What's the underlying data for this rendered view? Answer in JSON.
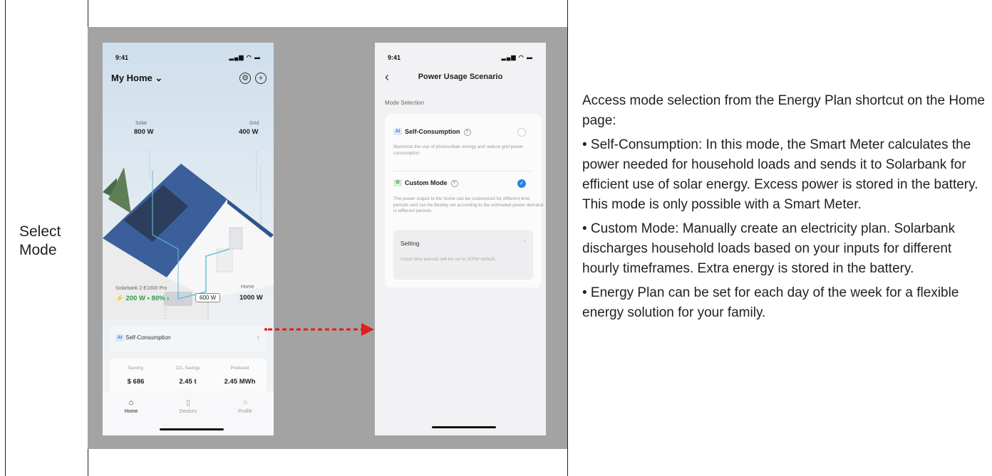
{
  "row_label": "Select\nMode",
  "phone1": {
    "time": "9:41",
    "status_icons": "▂▄▆ ◠ ▬",
    "title": "My Home ⌄",
    "solar_label": "Solar",
    "solar_value": "800 W",
    "grid_label": "Grid",
    "grid_value": "400 W",
    "device_label": "Solarbank 2 E1600 Pro",
    "device_value": "⚡ 200 W • 80% ›",
    "flow_value": "600 W",
    "home_label": "Home",
    "home_value": "1000 W",
    "mode_badge": "AI",
    "mode_text": "Self-Consumption",
    "mode_chevron": "›",
    "stats": [
      {
        "key": "Earning",
        "value": "$ 686"
      },
      {
        "key": "CO₂ Savings",
        "value": "2.45 t"
      },
      {
        "key": "Produced",
        "value": "2.45 MWh"
      }
    ],
    "tabs": [
      {
        "label": "Home",
        "icon": "house-icon"
      },
      {
        "label": "Devices",
        "icon": "devices-icon"
      },
      {
        "label": "Profile",
        "icon": "profile-icon"
      }
    ]
  },
  "phone2": {
    "time": "9:41",
    "status_icons": "▂▄▆ ◠ ▬",
    "title": "Power Usage Scenario",
    "section": "Mode Selection",
    "opt1_badge": "AI",
    "opt1_title": "Self-Consumption",
    "opt1_desc": "Maximize the use of photovoltaic energy and reduce grid power consumption",
    "opt2_title": "Custom Mode",
    "opt2_desc": "The power output to the home can be customized for different time periods and can be flexibly set according to the estimated power demand in different periods.",
    "setting_title": "Setting",
    "setting_desc": "Unset time periods will be set to 200W default."
  },
  "description": {
    "intro": "Access mode selection from the Energy Plan shortcut on the Home page:",
    "bullet1": "• Self-Consumption: In this mode, the Smart Meter calculates the power needed for household loads and sends it to Solarbank for efficient use of solar energy. Excess power is stored in the battery. This mode is only possible with a Smart Meter.",
    "bullet2": "• Custom Mode: Manually create an electricity plan. Solarbank discharges household loads based on your inputs for different hourly timeframes. Extra energy is stored in the battery.",
    "bullet3": "• Energy Plan can be set for each day of the week for a flexible energy solution for your family."
  },
  "colors": {
    "arrow": "#e11d1d",
    "accent": "#2a82e4",
    "gray_bg": "#a3a3a3"
  }
}
